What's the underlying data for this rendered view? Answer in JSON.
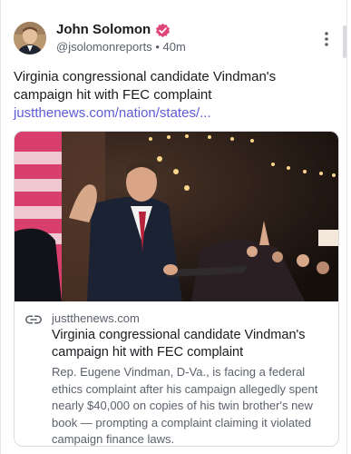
{
  "post": {
    "author_name": "John Solomon",
    "handle": "@jsolomonreports",
    "separator": "•",
    "time": "40m",
    "text": "Virginia congressional candidate Vindman's campaign hit with FEC complaint ",
    "link_text": "justthenews.com/nation/states/...",
    "icons": {
      "verified": "verified-badge-icon",
      "more": "more-vertical-icon",
      "link": "link-icon"
    },
    "colors": {
      "link": "#5b5bd6",
      "verified": "#e0457a",
      "secondary_text": "#5b616c"
    }
  },
  "card": {
    "domain": "justthenews.com",
    "title": "Virginia congressional candidate Vindman's campaign hit with FEC complaint",
    "description": "Rep. Eugene Vindman, D-Va., is facing a federal ethics complaint after his campaign allegedly spent nearly $40,000 on copies of his twin brother's new book — prompting a complaint claiming it violated campaign finance laws."
  }
}
